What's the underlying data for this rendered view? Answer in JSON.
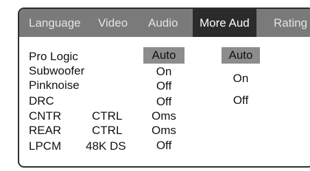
{
  "tabs": [
    {
      "label": "Language"
    },
    {
      "label": "Video"
    },
    {
      "label": "Audio"
    },
    {
      "label": "More Aud",
      "active": true
    },
    {
      "label": "Rating"
    }
  ],
  "settings": [
    {
      "label": "Pro Logic",
      "sub": "",
      "value": "Auto",
      "selected": true
    },
    {
      "label": "Subwoofer",
      "sub": "",
      "value": "On"
    },
    {
      "label": "Pinknoise",
      "sub": "",
      "value": "Off"
    },
    {
      "label": "DRC",
      "sub": "",
      "value": "Off"
    },
    {
      "label": "CNTR",
      "sub": "CTRL",
      "value": "Oms"
    },
    {
      "label": "REAR",
      "sub": "CTRL",
      "value": "Oms"
    },
    {
      "label": "LPCM",
      "sub": "48K DS",
      "value": "Off"
    }
  ],
  "options": [
    {
      "label": "Auto",
      "selected": true
    },
    {
      "label": "On"
    },
    {
      "label": "Off"
    }
  ],
  "colors": {
    "tab_bar": "#7a7a7a",
    "active_tab": "#2b2b2b",
    "highlight": "#8c8c8c",
    "border": "#2a2a2a"
  }
}
